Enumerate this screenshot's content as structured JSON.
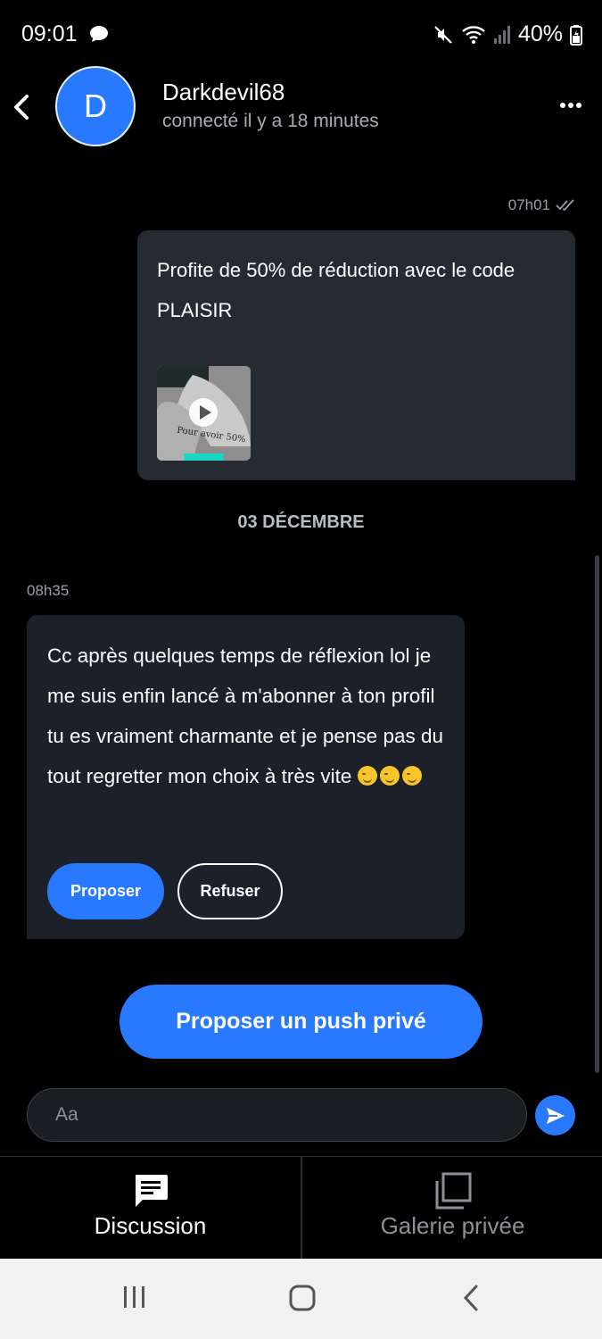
{
  "status_bar": {
    "time": "09:01",
    "battery": "40%",
    "icons": [
      "chat-bubble-icon",
      "mute-icon",
      "wifi-icon",
      "signal-icon",
      "battery-icon"
    ]
  },
  "header": {
    "avatar_letter": "D",
    "username": "Darkdevil68",
    "presence": "connecté il y a 18 minutes"
  },
  "messages": {
    "outgoing": {
      "time": "07h01",
      "text": "Profite de 50% de réduction avec le code PLAISIR",
      "thumbnail_caption": "Pour avoir 50%"
    },
    "date_separator": "03 DÉCEMBRE",
    "incoming": {
      "time": "08h35",
      "text": "Cc après quelques temps de réflexion lol je me suis enfin lancé à m'abonner à ton profil tu es vraiment charmante et je pense pas du tout regretter mon choix à très vite",
      "emoji_count": 3,
      "accept_label": "Proposer",
      "decline_label": "Refuser"
    }
  },
  "push_button_label": "Proposer un push privé",
  "composer": {
    "placeholder": "Aa"
  },
  "tabs": [
    {
      "label": "Discussion",
      "icon": "chat-icon",
      "active": true
    },
    {
      "label": "Galerie privée",
      "icon": "gallery-icon",
      "active": false
    }
  ],
  "colors": {
    "accent": "#2979ff",
    "background": "#000000",
    "bubble_out": "#262b33",
    "bubble_in": "#1b2029"
  }
}
